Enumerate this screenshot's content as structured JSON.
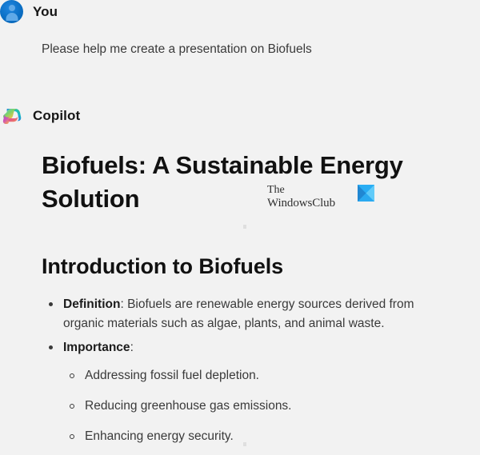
{
  "theme": {
    "background": "#f2f2f2",
    "text_primary": "#1b1b1b",
    "text_body": "#3a3a3a",
    "user_avatar_color": "#0b6fc4",
    "watermark_mark_color": "#1aa3f0"
  },
  "conversation": {
    "user_turn": {
      "sender": "You",
      "avatar_icon": "user-avatar-icon",
      "message": "Please help me create a presentation on Biofuels"
    },
    "assistant_turn": {
      "sender": "Copilot",
      "avatar_icon": "copilot-logo-icon",
      "deck_title": "Biofuels: A Sustainable Energy Solution",
      "section_heading": "Introduction to Biofuels",
      "bullets": [
        {
          "label": "Definition",
          "separator": ":",
          "text": " Biofuels are renewable energy sources derived from organic materials such as algae, plants, and animal waste.",
          "children": []
        },
        {
          "label": "Importance",
          "separator": ":",
          "text": "",
          "children": [
            "Addressing fossil fuel depletion.",
            "Reducing greenhouse gas emissions.",
            "Enhancing energy security."
          ]
        }
      ]
    }
  },
  "watermark": {
    "line1": "The",
    "line2": "WindowsClub",
    "mark_icon": "windowsclub-logo-icon"
  }
}
